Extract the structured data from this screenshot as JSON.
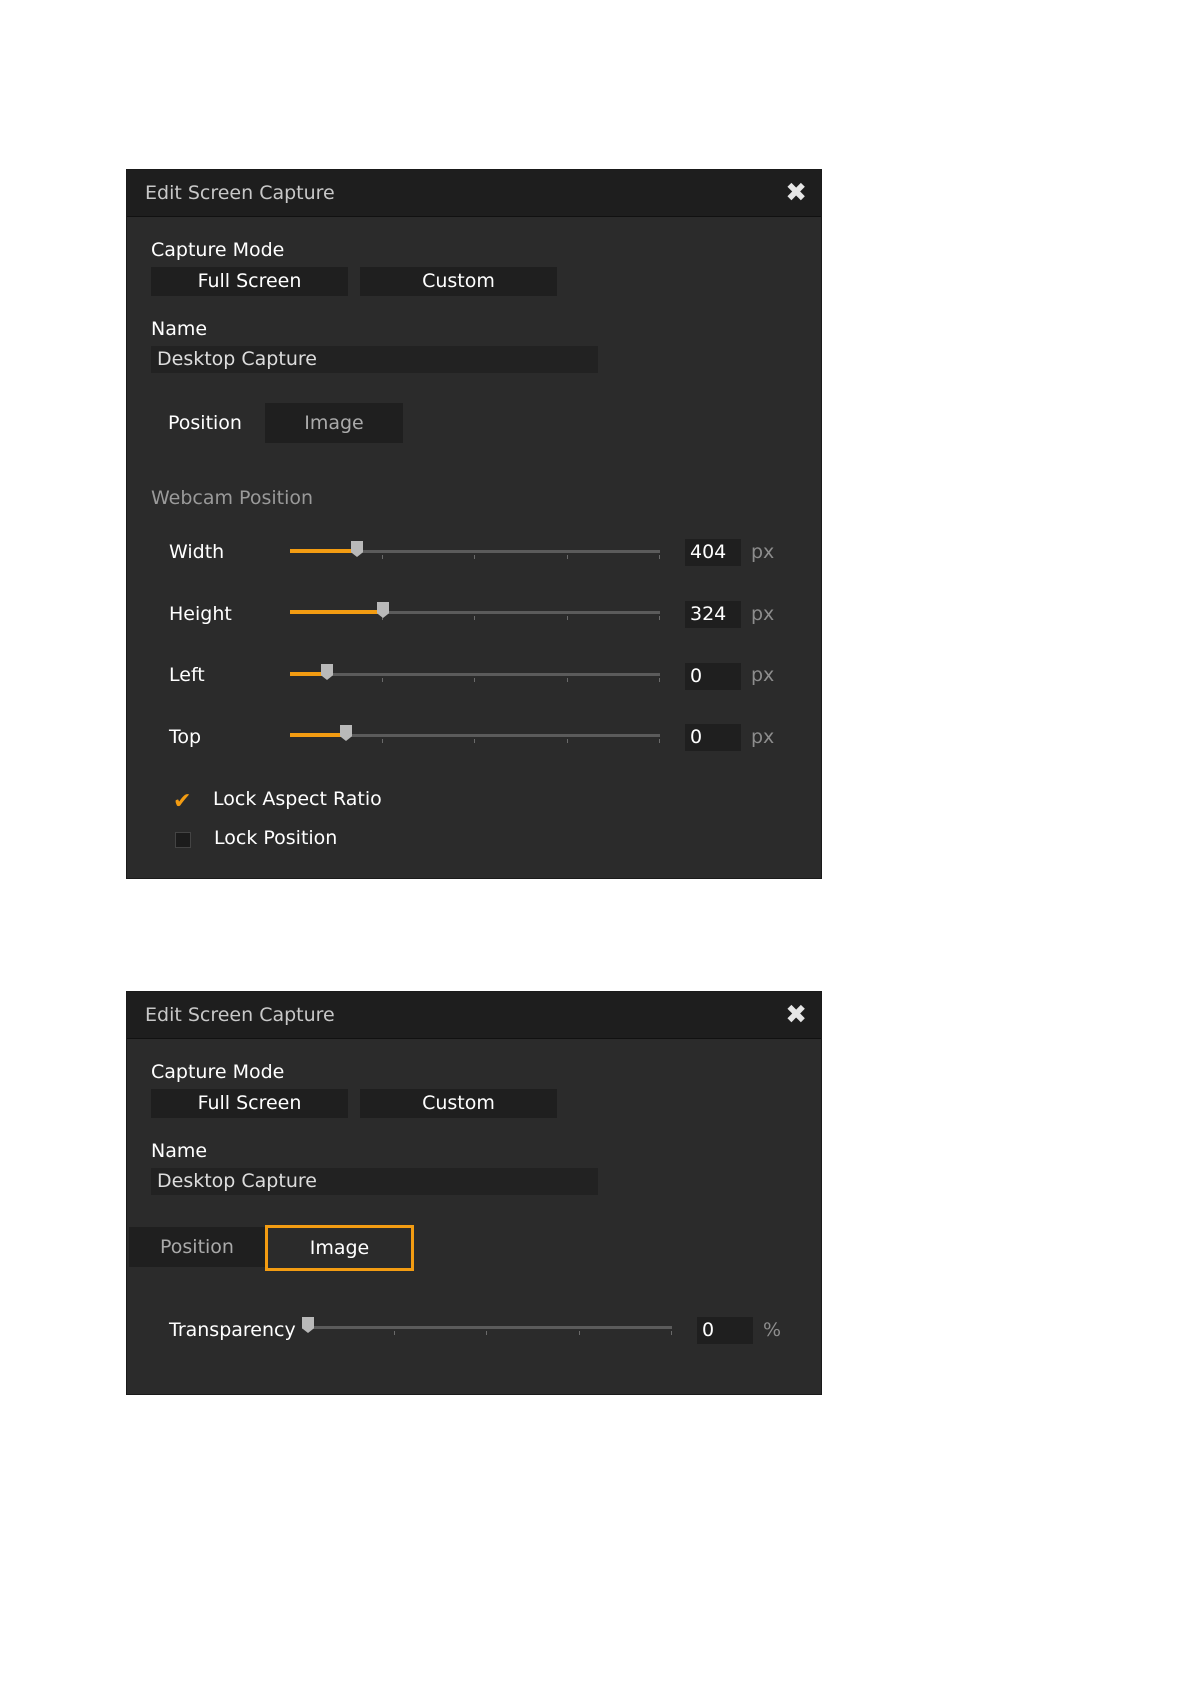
{
  "dialog_top": {
    "title": "Edit Screen Capture",
    "close_glyph": "✖",
    "capture_mode_label": "Capture Mode",
    "capture_modes": [
      "Full Screen",
      "Custom"
    ],
    "name_label": "Name",
    "name_value": "Desktop Capture",
    "tabs": [
      "Position",
      "Image"
    ],
    "section_title": "Webcam Position",
    "sliders": [
      {
        "label": "Width",
        "value": "404",
        "unit": "px",
        "fill": 0.18
      },
      {
        "label": "Height",
        "value": "324",
        "unit": "px",
        "fill": 0.25
      },
      {
        "label": "Left",
        "value": "0",
        "unit": "px",
        "fill": 0.1
      },
      {
        "label": "Top",
        "value": "0",
        "unit": "px",
        "fill": 0.15
      }
    ],
    "checkboxes": [
      {
        "label": "Lock Aspect Ratio",
        "checked": true
      },
      {
        "label": "Lock Position",
        "checked": false
      }
    ]
  },
  "dialog_bottom": {
    "title": "Edit Screen Capture",
    "close_glyph": "✖",
    "capture_mode_label": "Capture Mode",
    "capture_modes": [
      "Full Screen",
      "Custom"
    ],
    "name_label": "Name",
    "name_value": "Desktop Capture",
    "tabs": [
      "Position",
      "Image"
    ],
    "transparency": {
      "label": "Transparency",
      "value": "0",
      "unit": "%",
      "fill": 0.0
    }
  },
  "colors": {
    "accent": "#f39c12",
    "panel": "#2b2b2b",
    "titlebar": "#1e1e1e"
  },
  "icons": {
    "close": "close-icon",
    "check": "checkmark-icon"
  }
}
